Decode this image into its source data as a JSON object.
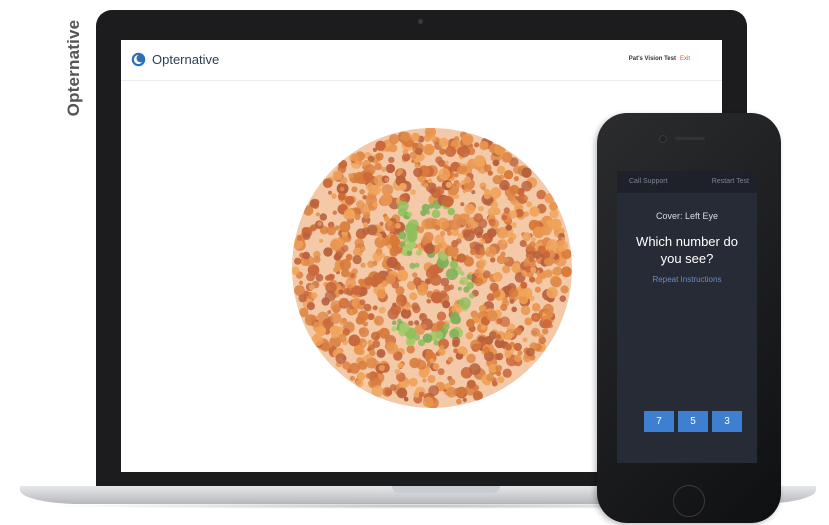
{
  "watermark": "Opternative",
  "laptop": {
    "brand_name": "Opternative",
    "header_title": "Pat's Vision Test",
    "exit_label": "Exit",
    "plate_number": "5",
    "colors": {
      "brand": "#2d3e57",
      "exit": "#e1472b",
      "plate_dots": [
        "#e08a4a",
        "#d87a3a",
        "#c9683a",
        "#f0a35a",
        "#b85f3c",
        "#e9964f"
      ],
      "figure_dots": [
        "#8fbf5a",
        "#a7c96a",
        "#7fb05a"
      ]
    }
  },
  "phone": {
    "call_support": "Call Support",
    "restart_test": "Restart Test",
    "cover_label": "Cover: Left Eye",
    "question": "Which number do you see?",
    "repeat_instructions": "Repeat Instructions",
    "answers": [
      "7",
      "5",
      "3"
    ],
    "colors": {
      "screen": "#272b35",
      "button": "#3f7fd1",
      "link": "#6a8cc0"
    }
  }
}
